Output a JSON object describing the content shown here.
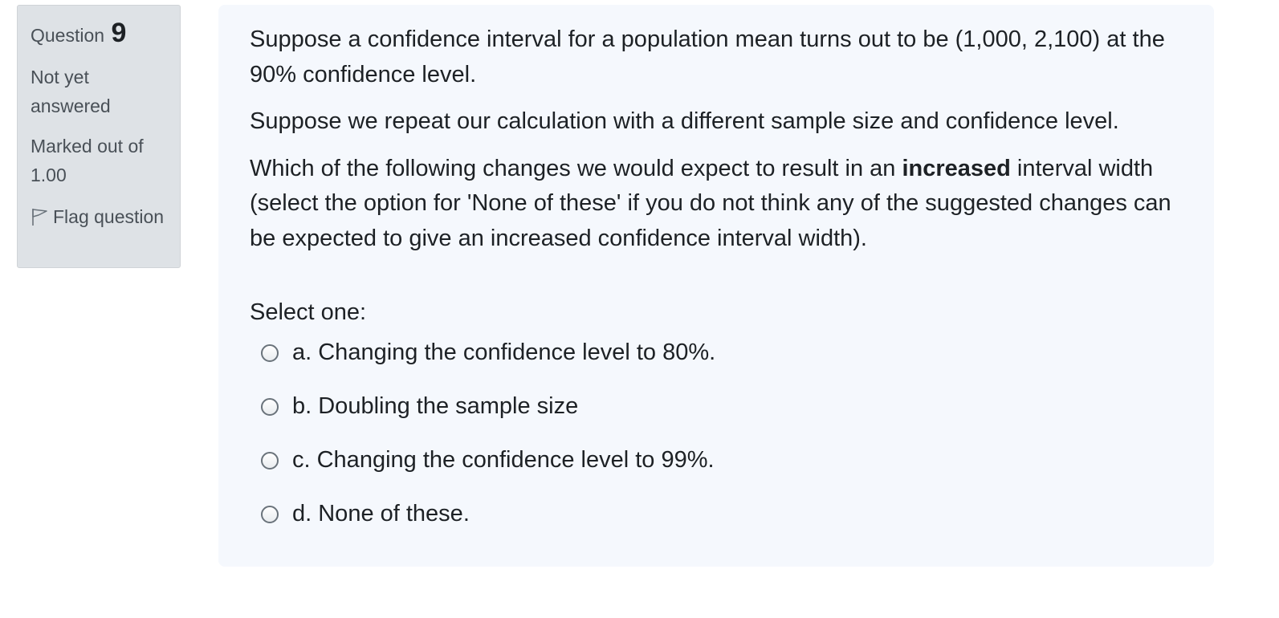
{
  "question_info": {
    "label": "Question",
    "number": "9",
    "status": "Not yet answered",
    "marked": "Marked out of 1.00",
    "flag_label": "Flag question"
  },
  "question": {
    "para1": "Suppose a confidence interval for a population mean turns out to be (1,000, 2,100) at the 90% confidence level.",
    "para2": "Suppose we repeat our calculation with a different sample size and confidence level.",
    "para3_before": "Which of the following changes we would expect to result in an ",
    "para3_bold": "increased",
    "para3_after": " interval width (select the option for 'None of these' if you do not think any of the suggested changes can be expected to give an increased confidence interval width).",
    "select_prompt": "Select one:",
    "options": [
      {
        "label": "a. Changing the confidence level to 80%."
      },
      {
        "label": "b. Doubling the sample size"
      },
      {
        "label": "c. Changing the confidence level to 99%."
      },
      {
        "label": "d. None of these."
      }
    ]
  },
  "icons": {
    "flag": "flag-icon",
    "radio": "radio-button"
  }
}
